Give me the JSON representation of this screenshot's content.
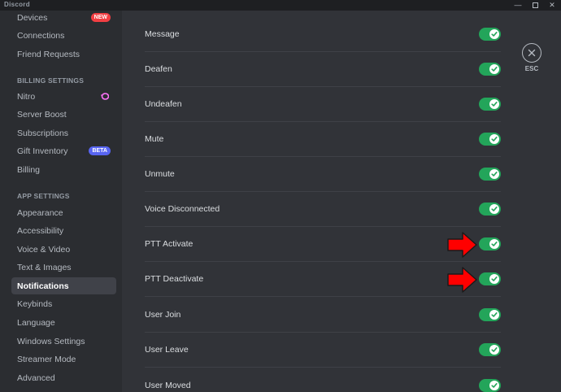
{
  "app": {
    "title": "Discord"
  },
  "sidebar": {
    "top_items": [
      {
        "label": "Devices",
        "badge": "NEW"
      },
      {
        "label": "Connections"
      },
      {
        "label": "Friend Requests"
      }
    ],
    "billing_header": "BILLING SETTINGS",
    "billing_items": [
      {
        "label": "Nitro"
      },
      {
        "label": "Server Boost"
      },
      {
        "label": "Subscriptions"
      },
      {
        "label": "Gift Inventory",
        "badge": "BETA"
      },
      {
        "label": "Billing"
      }
    ],
    "app_header": "APP SETTINGS",
    "app_items": [
      {
        "label": "Appearance"
      },
      {
        "label": "Accessibility"
      },
      {
        "label": "Voice & Video"
      },
      {
        "label": "Text & Images"
      },
      {
        "label": "Notifications",
        "active": true
      },
      {
        "label": "Keybinds"
      },
      {
        "label": "Language"
      },
      {
        "label": "Windows Settings"
      },
      {
        "label": "Streamer Mode"
      },
      {
        "label": "Advanced"
      }
    ]
  },
  "sounds": [
    {
      "label": "Message",
      "enabled": true
    },
    {
      "label": "Deafen",
      "enabled": true
    },
    {
      "label": "Undeafen",
      "enabled": true
    },
    {
      "label": "Mute",
      "enabled": true
    },
    {
      "label": "Unmute",
      "enabled": true
    },
    {
      "label": "Voice Disconnected",
      "enabled": true
    },
    {
      "label": "PTT Activate",
      "enabled": true,
      "highlighted": true
    },
    {
      "label": "PTT Deactivate",
      "enabled": true,
      "highlighted": true
    },
    {
      "label": "User Join",
      "enabled": true
    },
    {
      "label": "User Leave",
      "enabled": true
    },
    {
      "label": "User Moved",
      "enabled": true
    }
  ],
  "close": {
    "label": "ESC"
  },
  "icons": {
    "close": "close-icon",
    "check": "check-icon",
    "nitro": "nitro-icon",
    "arrow": "red-arrow-icon"
  },
  "colors": {
    "toggle_on": "#23a55a",
    "arrow": "#ff0000",
    "badge_new": "#f23f43",
    "badge_beta": "#5865f2",
    "nitro": "#ff73fa"
  }
}
